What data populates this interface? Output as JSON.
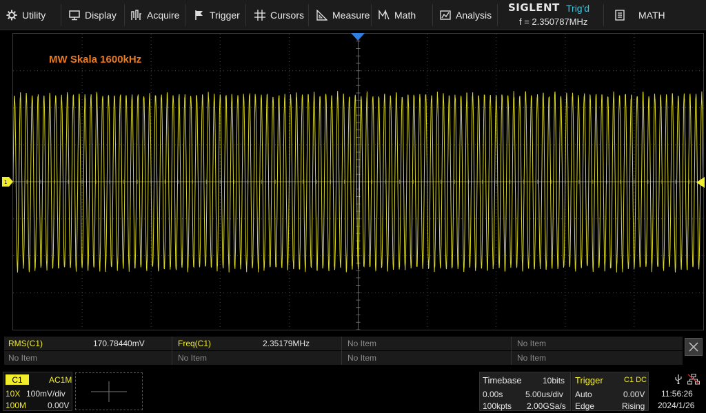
{
  "menu": {
    "items": [
      {
        "label": "Utility",
        "icon": "gear-icon"
      },
      {
        "label": "Display",
        "icon": "monitor-icon"
      },
      {
        "label": "Acquire",
        "icon": "acquire-icon"
      },
      {
        "label": "Trigger",
        "icon": "flag-icon"
      },
      {
        "label": "Cursors",
        "icon": "crosshair-icon"
      },
      {
        "label": "Measure",
        "icon": "ruler-icon"
      },
      {
        "label": "Math",
        "icon": "math-icon"
      },
      {
        "label": "Analysis",
        "icon": "analysis-icon"
      }
    ],
    "brand": "SIGLENT",
    "trigger_status": "Trig'd",
    "frequency": "f = 2.350787MHz",
    "math_label": "MATH"
  },
  "screen": {
    "label": "MW Skala 1600kHz",
    "trace_color": "#f2ee2e",
    "label_color": "#e87b22"
  },
  "measurements": {
    "row1": [
      {
        "name": "RMS(C1)",
        "value": "170.78440mV"
      },
      {
        "name": "Freq(C1)",
        "value": "2.35179MHz"
      },
      {
        "name": "No Item",
        "value": ""
      },
      {
        "name": "No Item",
        "value": ""
      }
    ],
    "row2": [
      "No Item",
      "No Item",
      "No Item",
      "No Item"
    ]
  },
  "channel": {
    "name": "C1",
    "coupling": "AC1M",
    "probe": "10X",
    "scale": "100mV/div",
    "bandwidth": "100M",
    "offset": "0.00V"
  },
  "timebase": {
    "title": "Timebase",
    "bits": "10bits",
    "delay": "0.00s",
    "scale": "5.00us/div",
    "points": "100kpts",
    "rate": "2.00GSa/s"
  },
  "trigger": {
    "title": "Trigger",
    "source": "C1 DC",
    "mode": "Auto",
    "level": "0.00V",
    "type": "Edge",
    "slope": "Rising"
  },
  "system": {
    "time": "11:56:26",
    "date": "2024/1/26"
  }
}
